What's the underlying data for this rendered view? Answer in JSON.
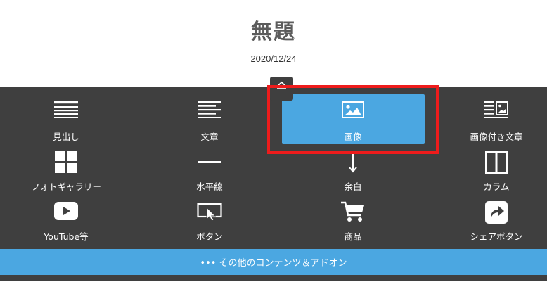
{
  "page": {
    "title": "無題",
    "date": "2020/12/24"
  },
  "panel": {
    "items": [
      {
        "label": "見出し",
        "icon": "heading-icon"
      },
      {
        "label": "文章",
        "icon": "text-icon"
      },
      {
        "label": "画像",
        "icon": "image-icon",
        "selected": true
      },
      {
        "label": "画像付き文章",
        "icon": "image-with-text-icon"
      },
      {
        "label": "フォトギャラリー",
        "icon": "photo-gallery-icon"
      },
      {
        "label": "水平線",
        "icon": "horizontal-line-icon"
      },
      {
        "label": "余白",
        "icon": "spacer-icon"
      },
      {
        "label": "カラム",
        "icon": "columns-icon"
      },
      {
        "label": "YouTube等",
        "icon": "youtube-icon"
      },
      {
        "label": "ボタン",
        "icon": "button-icon"
      },
      {
        "label": "商品",
        "icon": "cart-icon"
      },
      {
        "label": "シェアボタン",
        "icon": "share-icon"
      }
    ],
    "more_label": "••• その他のコンテンツ＆アドオン"
  },
  "colors": {
    "panel_bg": "#3f3f3f",
    "accent_blue": "#4ba7e1",
    "highlight_red": "#ee1c1c"
  }
}
